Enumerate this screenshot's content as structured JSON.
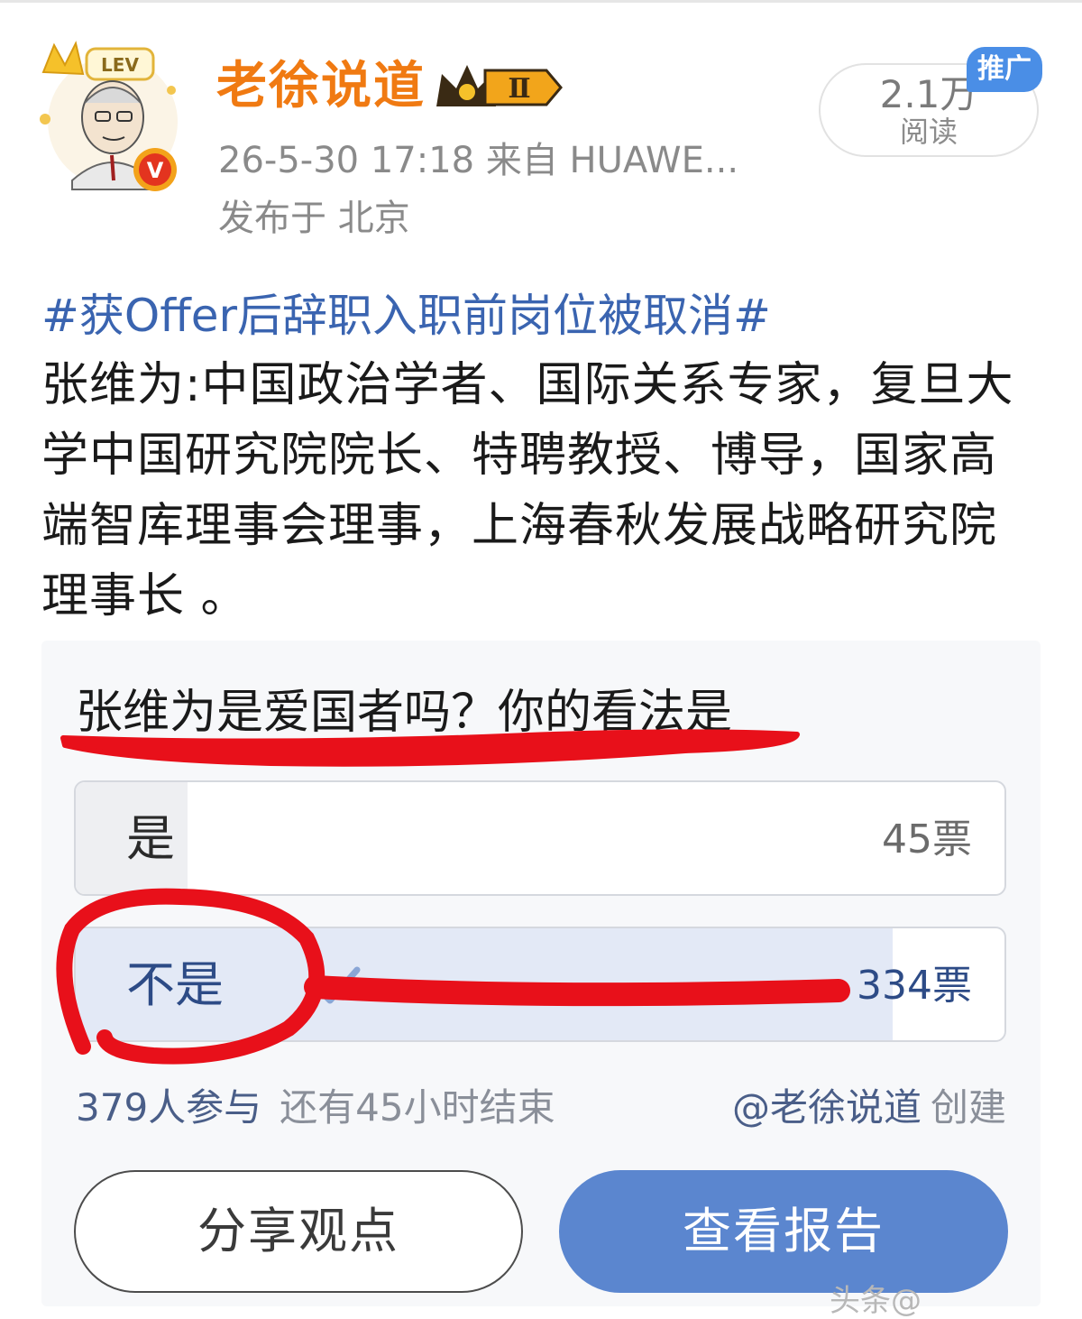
{
  "post": {
    "author": "老徐说道",
    "vip_level": "Ⅱ",
    "avatar_badge": "LEV",
    "verified_mark": "V",
    "meta_line": "26-5-30 17:18   来自 HUAWE...",
    "location": "发布于 北京",
    "reads_count": "2.1万",
    "reads_label": "阅读",
    "promo_tag": "推广",
    "topic": "#获Offer后辞职入职前岗位被取消#",
    "body": "张维为:中国政治学者、国际关系专家，复旦大学中国研究院院长、特聘教授、博导，国家高端智库理事会理事，上海春秋发展战略研究院理事长 。"
  },
  "poll": {
    "question": "张维为是爱国者吗？你的看法是",
    "options": [
      {
        "label": "是",
        "votes": "45票",
        "share": 0.12,
        "selected": false
      },
      {
        "label": "不是",
        "votes": "334票",
        "share": 0.88,
        "selected": true
      }
    ],
    "participants": "379人参与",
    "time_left": "还有45小时结束",
    "creator": "@老徐说道",
    "creator_suffix": "创建",
    "share_button": "分享观点",
    "report_button": "查看报告"
  },
  "bottom_fragment": "头条@",
  "colors": {
    "author": "#f07a12",
    "topic": "#3a64b0",
    "promo": "#4a8ee6",
    "report_button": "#5b86cf",
    "selected_fill": "#e3e9f6",
    "annotation_red": "#e8101a"
  },
  "icons": [
    "avatar-illustration",
    "crown-icon",
    "verified-icon",
    "check-icon"
  ]
}
